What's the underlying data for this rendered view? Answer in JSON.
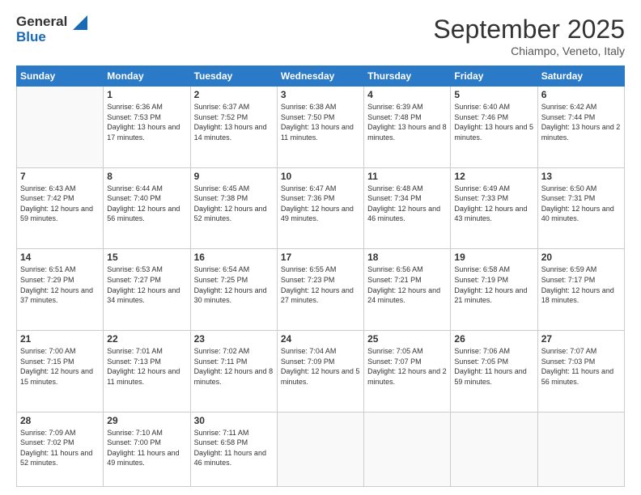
{
  "logo": {
    "line1": "General",
    "line2": "Blue"
  },
  "title": "September 2025",
  "location": "Chiampo, Veneto, Italy",
  "weekdays": [
    "Sunday",
    "Monday",
    "Tuesday",
    "Wednesday",
    "Thursday",
    "Friday",
    "Saturday"
  ],
  "weeks": [
    [
      {
        "day": "",
        "sunrise": "",
        "sunset": "",
        "daylight": ""
      },
      {
        "day": "1",
        "sunrise": "Sunrise: 6:36 AM",
        "sunset": "Sunset: 7:53 PM",
        "daylight": "Daylight: 13 hours and 17 minutes."
      },
      {
        "day": "2",
        "sunrise": "Sunrise: 6:37 AM",
        "sunset": "Sunset: 7:52 PM",
        "daylight": "Daylight: 13 hours and 14 minutes."
      },
      {
        "day": "3",
        "sunrise": "Sunrise: 6:38 AM",
        "sunset": "Sunset: 7:50 PM",
        "daylight": "Daylight: 13 hours and 11 minutes."
      },
      {
        "day": "4",
        "sunrise": "Sunrise: 6:39 AM",
        "sunset": "Sunset: 7:48 PM",
        "daylight": "Daylight: 13 hours and 8 minutes."
      },
      {
        "day": "5",
        "sunrise": "Sunrise: 6:40 AM",
        "sunset": "Sunset: 7:46 PM",
        "daylight": "Daylight: 13 hours and 5 minutes."
      },
      {
        "day": "6",
        "sunrise": "Sunrise: 6:42 AM",
        "sunset": "Sunset: 7:44 PM",
        "daylight": "Daylight: 13 hours and 2 minutes."
      }
    ],
    [
      {
        "day": "7",
        "sunrise": "Sunrise: 6:43 AM",
        "sunset": "Sunset: 7:42 PM",
        "daylight": "Daylight: 12 hours and 59 minutes."
      },
      {
        "day": "8",
        "sunrise": "Sunrise: 6:44 AM",
        "sunset": "Sunset: 7:40 PM",
        "daylight": "Daylight: 12 hours and 56 minutes."
      },
      {
        "day": "9",
        "sunrise": "Sunrise: 6:45 AM",
        "sunset": "Sunset: 7:38 PM",
        "daylight": "Daylight: 12 hours and 52 minutes."
      },
      {
        "day": "10",
        "sunrise": "Sunrise: 6:47 AM",
        "sunset": "Sunset: 7:36 PM",
        "daylight": "Daylight: 12 hours and 49 minutes."
      },
      {
        "day": "11",
        "sunrise": "Sunrise: 6:48 AM",
        "sunset": "Sunset: 7:34 PM",
        "daylight": "Daylight: 12 hours and 46 minutes."
      },
      {
        "day": "12",
        "sunrise": "Sunrise: 6:49 AM",
        "sunset": "Sunset: 7:33 PM",
        "daylight": "Daylight: 12 hours and 43 minutes."
      },
      {
        "day": "13",
        "sunrise": "Sunrise: 6:50 AM",
        "sunset": "Sunset: 7:31 PM",
        "daylight": "Daylight: 12 hours and 40 minutes."
      }
    ],
    [
      {
        "day": "14",
        "sunrise": "Sunrise: 6:51 AM",
        "sunset": "Sunset: 7:29 PM",
        "daylight": "Daylight: 12 hours and 37 minutes."
      },
      {
        "day": "15",
        "sunrise": "Sunrise: 6:53 AM",
        "sunset": "Sunset: 7:27 PM",
        "daylight": "Daylight: 12 hours and 34 minutes."
      },
      {
        "day": "16",
        "sunrise": "Sunrise: 6:54 AM",
        "sunset": "Sunset: 7:25 PM",
        "daylight": "Daylight: 12 hours and 30 minutes."
      },
      {
        "day": "17",
        "sunrise": "Sunrise: 6:55 AM",
        "sunset": "Sunset: 7:23 PM",
        "daylight": "Daylight: 12 hours and 27 minutes."
      },
      {
        "day": "18",
        "sunrise": "Sunrise: 6:56 AM",
        "sunset": "Sunset: 7:21 PM",
        "daylight": "Daylight: 12 hours and 24 minutes."
      },
      {
        "day": "19",
        "sunrise": "Sunrise: 6:58 AM",
        "sunset": "Sunset: 7:19 PM",
        "daylight": "Daylight: 12 hours and 21 minutes."
      },
      {
        "day": "20",
        "sunrise": "Sunrise: 6:59 AM",
        "sunset": "Sunset: 7:17 PM",
        "daylight": "Daylight: 12 hours and 18 minutes."
      }
    ],
    [
      {
        "day": "21",
        "sunrise": "Sunrise: 7:00 AM",
        "sunset": "Sunset: 7:15 PM",
        "daylight": "Daylight: 12 hours and 15 minutes."
      },
      {
        "day": "22",
        "sunrise": "Sunrise: 7:01 AM",
        "sunset": "Sunset: 7:13 PM",
        "daylight": "Daylight: 12 hours and 11 minutes."
      },
      {
        "day": "23",
        "sunrise": "Sunrise: 7:02 AM",
        "sunset": "Sunset: 7:11 PM",
        "daylight": "Daylight: 12 hours and 8 minutes."
      },
      {
        "day": "24",
        "sunrise": "Sunrise: 7:04 AM",
        "sunset": "Sunset: 7:09 PM",
        "daylight": "Daylight: 12 hours and 5 minutes."
      },
      {
        "day": "25",
        "sunrise": "Sunrise: 7:05 AM",
        "sunset": "Sunset: 7:07 PM",
        "daylight": "Daylight: 12 hours and 2 minutes."
      },
      {
        "day": "26",
        "sunrise": "Sunrise: 7:06 AM",
        "sunset": "Sunset: 7:05 PM",
        "daylight": "Daylight: 11 hours and 59 minutes."
      },
      {
        "day": "27",
        "sunrise": "Sunrise: 7:07 AM",
        "sunset": "Sunset: 7:03 PM",
        "daylight": "Daylight: 11 hours and 56 minutes."
      }
    ],
    [
      {
        "day": "28",
        "sunrise": "Sunrise: 7:09 AM",
        "sunset": "Sunset: 7:02 PM",
        "daylight": "Daylight: 11 hours and 52 minutes."
      },
      {
        "day": "29",
        "sunrise": "Sunrise: 7:10 AM",
        "sunset": "Sunset: 7:00 PM",
        "daylight": "Daylight: 11 hours and 49 minutes."
      },
      {
        "day": "30",
        "sunrise": "Sunrise: 7:11 AM",
        "sunset": "Sunset: 6:58 PM",
        "daylight": "Daylight: 11 hours and 46 minutes."
      },
      {
        "day": "",
        "sunrise": "",
        "sunset": "",
        "daylight": ""
      },
      {
        "day": "",
        "sunrise": "",
        "sunset": "",
        "daylight": ""
      },
      {
        "day": "",
        "sunrise": "",
        "sunset": "",
        "daylight": ""
      },
      {
        "day": "",
        "sunrise": "",
        "sunset": "",
        "daylight": ""
      }
    ]
  ]
}
